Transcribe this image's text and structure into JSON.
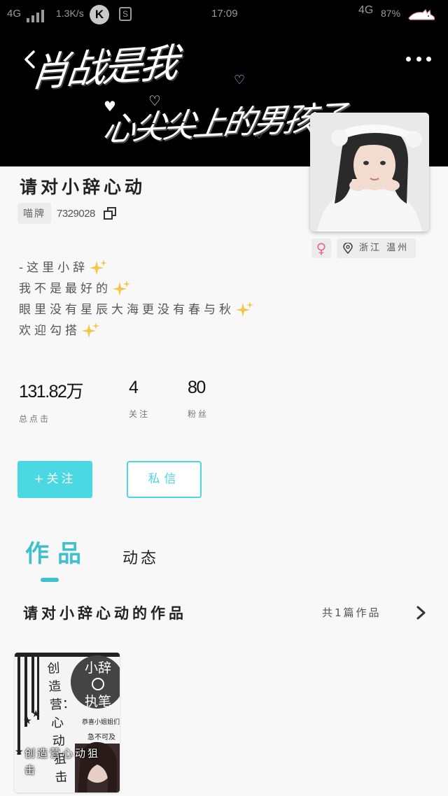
{
  "status_bar": {
    "network_left": "4G",
    "speed": "1.3K/s",
    "k_label": "K",
    "s_label": "S",
    "time": "17:09",
    "network_right": "4G",
    "battery": "87%"
  },
  "banner": {
    "line1": "肖战是我",
    "line2": "心尖尖上的男孩子"
  },
  "profile": {
    "username": "请对小辞心动",
    "id_tag": "喵牌",
    "id_number": "7329028",
    "gender_symbol": "♀",
    "location": "浙江 温州"
  },
  "bio": [
    "-这里小辞",
    "我不是最好的",
    "眼里没有星辰大海更没有春与秋",
    "欢迎勾搭"
  ],
  "stats": [
    {
      "value": "131.82万",
      "label": "总点击"
    },
    {
      "value": "4",
      "label": "关注"
    },
    {
      "value": "80",
      "label": "粉丝"
    }
  ],
  "actions": {
    "follow": "+关注",
    "message": "私信"
  },
  "tabs": {
    "works": "作品",
    "moments": "动态"
  },
  "works_section": {
    "title": "请对小辞心动的作品",
    "count": "共1篇作品"
  },
  "work_card": {
    "cover_text_1": "小辞",
    "cover_text_2": "执笔",
    "cover_side": "创造营：心动狙击",
    "cover_small_1": "恭喜小姐姐们入围",
    "cover_small_2": "急不可及",
    "caption": "创造营心动狙击"
  },
  "colors": {
    "accent": "#4ad8e3",
    "accent_dark": "#3ec1cc",
    "banner_bg": "#000000",
    "female": "#e0708a"
  }
}
